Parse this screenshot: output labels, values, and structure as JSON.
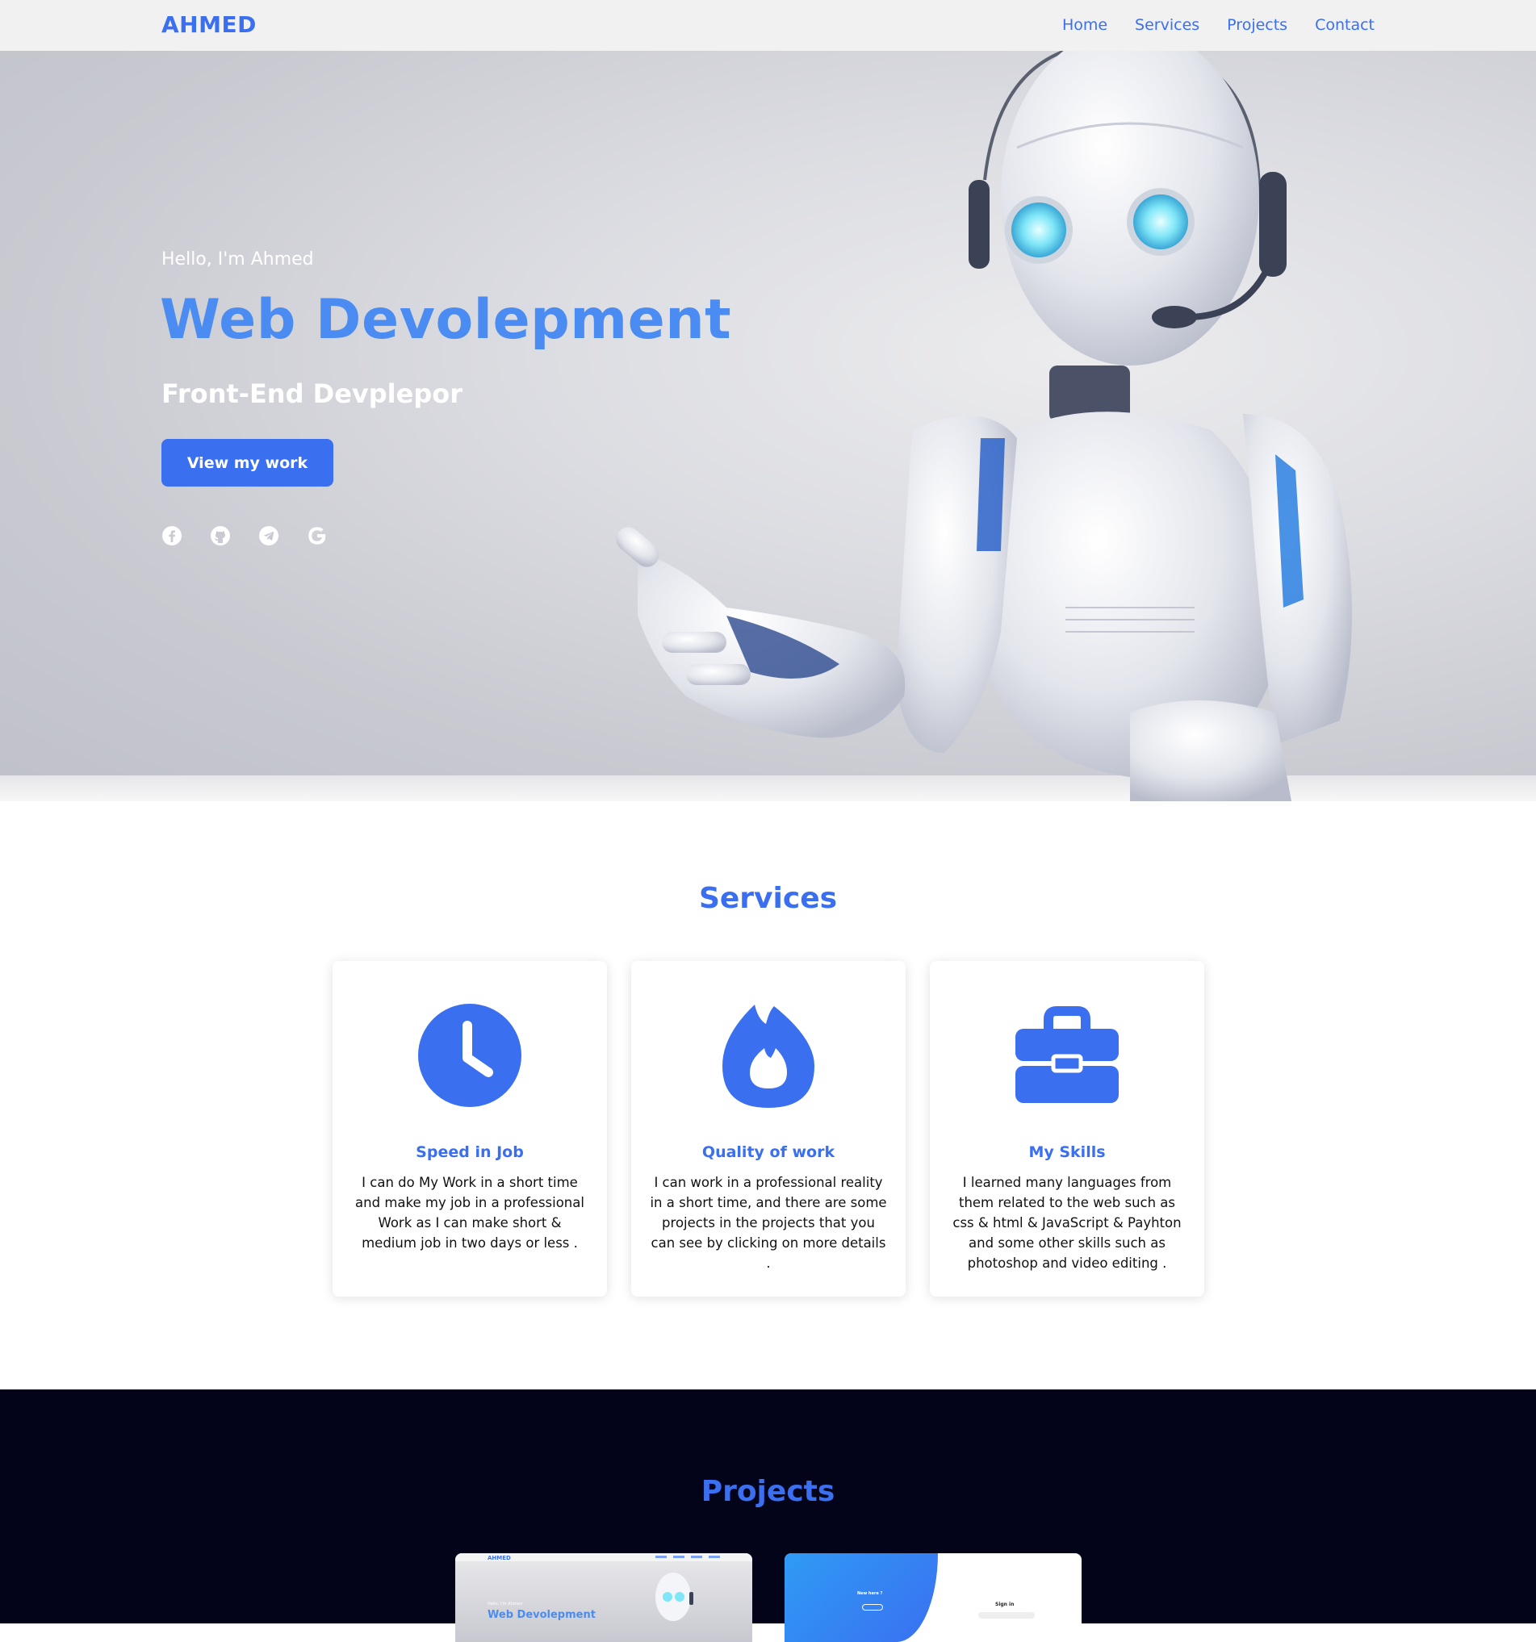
{
  "navbar": {
    "brand": "AHMED",
    "links": [
      "Home",
      "Services",
      "Projects",
      "Contact"
    ]
  },
  "hero": {
    "greeting": "Hello, I'm Ahmed",
    "title": "Web Devolepment",
    "subtitle": "Front-End Devplepor",
    "button_label": "View my work",
    "socials": [
      "facebook-icon",
      "github-icon",
      "telegram-icon",
      "google-icon"
    ]
  },
  "services": {
    "title": "Services",
    "cards": [
      {
        "icon": "clock-icon",
        "title": "Speed in Job",
        "text": "I can do My Work in a short time and make my job in a professional Work as I can make short & medium job in two days or less ."
      },
      {
        "icon": "fire-icon",
        "title": "Quality of work",
        "text": "I can work in a professional reality in a short time, and there are some projects in the projects that you can see by clicking on more details ."
      },
      {
        "icon": "briefcase-icon",
        "title": "My Skills",
        "text": "I learned many languages from them related to the web such as css & html & JavaScript & Payhton and some other skills such as photoshop and video editing ."
      }
    ]
  },
  "projects": {
    "title": "Projects",
    "thumb1": {
      "brand": "AHMED",
      "greeting": "Hello, I'm Ahmed",
      "title": "Web Devolepment"
    },
    "thumb2": {
      "panel_title": "New here ?",
      "heading": "Sign in"
    }
  },
  "colors": {
    "accent": "#3a6ff0",
    "hero_title": "#4a8cf2",
    "navbar_bg": "#f1f1f1",
    "projects_bg": "#03041a"
  }
}
